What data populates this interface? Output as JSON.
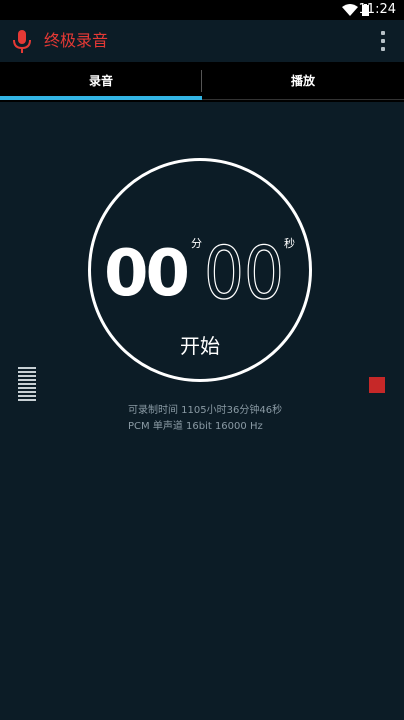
{
  "status_bar": {
    "time": "11:24",
    "icons": [
      "wifi-icon",
      "battery-icon"
    ]
  },
  "action_bar": {
    "title": "终极录音",
    "title_color": "#e53935",
    "icon": "microphone-icon",
    "menu_icon": "overflow-menu-icon"
  },
  "tabs": [
    {
      "label": "录音",
      "selected": true
    },
    {
      "label": "播放",
      "selected": false
    }
  ],
  "accent_color": "#33b5e5",
  "timer": {
    "minutes": "00",
    "minutes_unit": "分",
    "seconds": "00",
    "seconds_unit": "秒",
    "action_label": "开始"
  },
  "info": {
    "remaining": "可录制时间 1105小时36分钟46秒",
    "format": "PCM 单声道 16bit 16000 Hz"
  },
  "controls": {
    "level_meter_icon": "level-meter-icon",
    "stop_icon": "stop-icon",
    "stop_color": "#c62828"
  }
}
